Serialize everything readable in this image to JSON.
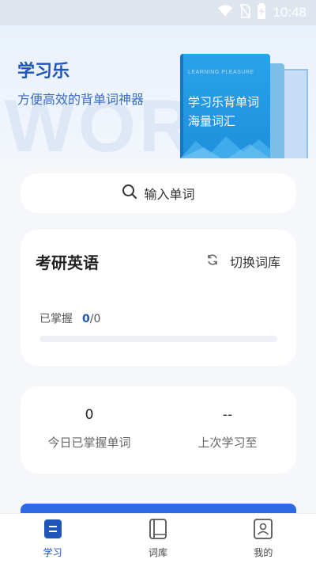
{
  "status_bar": {
    "time": "10:48"
  },
  "hero": {
    "title": "学习乐",
    "subtitle": "方便高效的背单词神器",
    "watermark": "WORD",
    "book": {
      "small_text": "LEARNING PLEASURE",
      "line1": "学习乐背单词",
      "line2": "海量词汇"
    }
  },
  "search": {
    "label": "输入单词"
  },
  "word_bank": {
    "title": "考研英语",
    "switch_label": "切换词库",
    "mastered_label": "已掌握",
    "mastered_count": "0",
    "mastered_total": "/0",
    "progress": 0
  },
  "stats": {
    "today": {
      "value": "0",
      "label": "今日已掌握单词"
    },
    "last": {
      "value": "--",
      "label": "上次学习至"
    }
  },
  "tabbar": {
    "items": [
      {
        "label": "学习",
        "active": true
      },
      {
        "label": "词库",
        "active": false
      },
      {
        "label": "我的",
        "active": false
      }
    ]
  },
  "colors": {
    "accent": "#1f56b8",
    "primary_button": "#2e6ae6",
    "background": "#f5f7fb"
  }
}
